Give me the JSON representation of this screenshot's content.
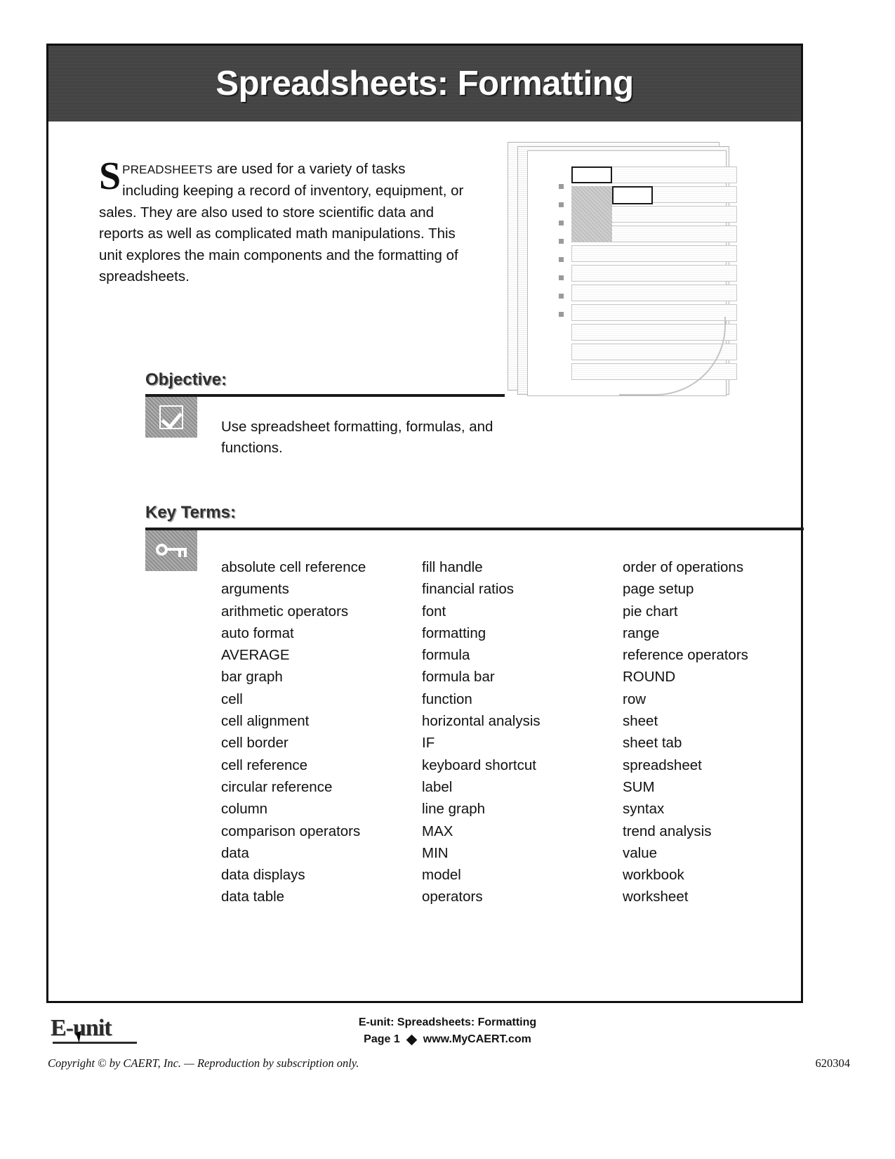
{
  "document": {
    "title": "Spreadsheets: Formatting"
  },
  "intro": {
    "dropcap": "S",
    "smallcaps": "PREADSHEETS",
    "body": " are used for a variety of tasks including keeping a record of inventory, equipment, or sales. They are also used to store scientific data and reports as well as complicated math manipulations. This unit explores the main components and the formatting of spreadsheets."
  },
  "illustration": {
    "icon": "spreadsheet-pages-illustration"
  },
  "objective": {
    "heading": "Objective:",
    "icon": "checkbox-icon",
    "text": "Use spreadsheet formatting, formulas, and functions."
  },
  "key_terms": {
    "heading": "Key Terms:",
    "icon": "key-icon",
    "columns": [
      [
        "absolute cell reference",
        "arguments",
        "arithmetic operators",
        "auto format",
        "AVERAGE",
        "bar graph",
        "cell",
        "cell alignment",
        "cell border",
        "cell reference",
        "circular reference",
        "column",
        "comparison operators",
        "data",
        "data displays",
        "data table"
      ],
      [
        "fill handle",
        "financial ratios",
        "font",
        "formatting",
        "formula",
        "formula bar",
        "function",
        "horizontal analysis",
        "IF",
        "keyboard shortcut",
        "label",
        "line graph",
        "MAX",
        "MIN",
        "model",
        "operators"
      ],
      [
        "order of operations",
        "page setup",
        "pie chart",
        "range",
        "reference operators",
        "ROUND",
        "row",
        "sheet",
        "sheet tab",
        "spreadsheet",
        "SUM",
        "syntax",
        "trend analysis",
        "value",
        "workbook",
        "worksheet"
      ]
    ]
  },
  "footer": {
    "logo_text": "E-unit",
    "unit_line": "E-unit: Spreadsheets: Formatting",
    "page_label": "Page 1",
    "website": "www.MyCAERT.com",
    "copyright": "Copyright © by CAERT, Inc. — Reproduction by subscription only.",
    "code": "620304"
  },
  "colors": {
    "banner": "#3b3b3b",
    "icon_box": "#8f8f8f",
    "rule": "#1a1a1a"
  }
}
